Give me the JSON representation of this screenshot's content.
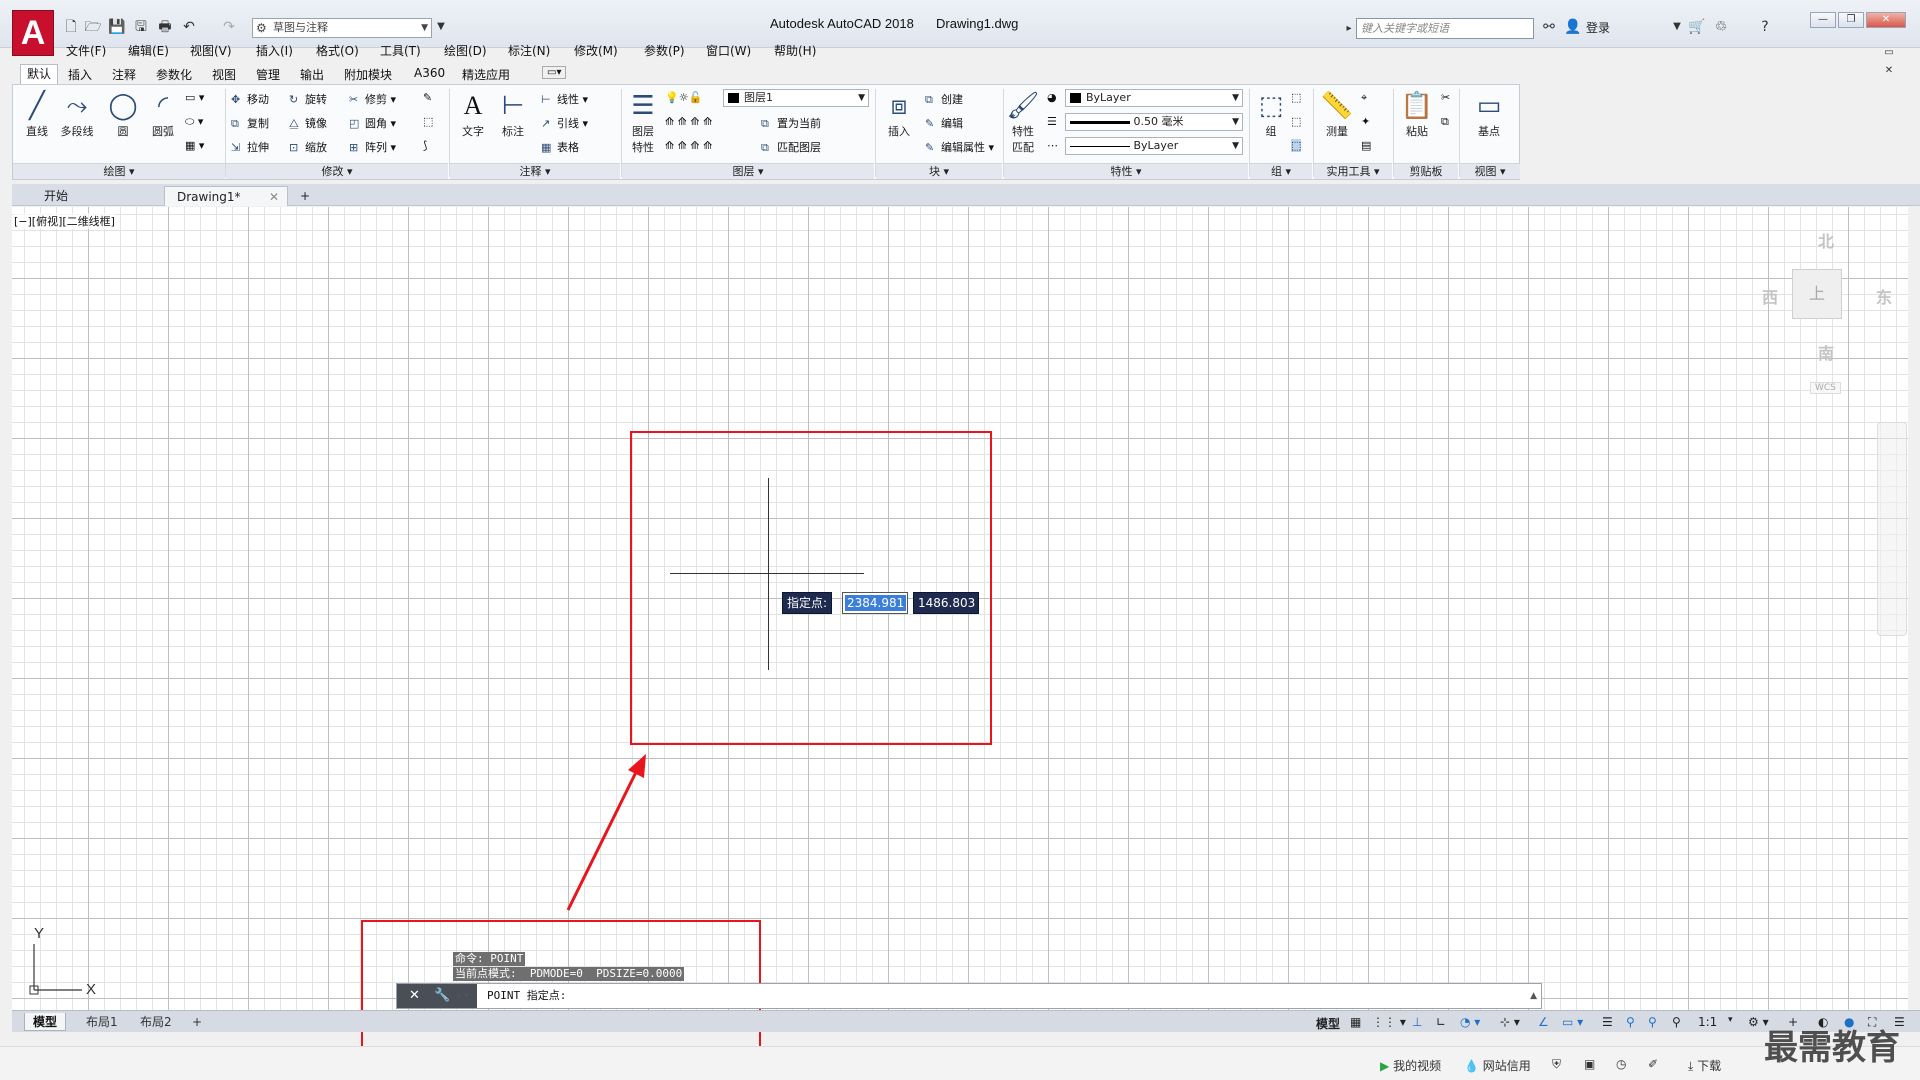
{
  "window": {
    "app_title": "Autodesk AutoCAD 2018",
    "doc_title": "Drawing1.dwg",
    "workspace": "草图与注释",
    "search_placeholder": "键入关键字或短语",
    "login": "登录",
    "logo_letter": "A"
  },
  "menu": [
    "文件(F)",
    "编辑(E)",
    "视图(V)",
    "插入(I)",
    "格式(O)",
    "工具(T)",
    "绘图(D)",
    "标注(N)",
    "修改(M)",
    "参数(P)",
    "窗口(W)",
    "帮助(H)"
  ],
  "ribbon_tabs": [
    "默认",
    "插入",
    "注释",
    "参数化",
    "视图",
    "管理",
    "输出",
    "附加模块",
    "A360",
    "精选应用"
  ],
  "ribbon": {
    "draw": {
      "title": "绘图",
      "tools": [
        "直线",
        "多段线",
        "圆",
        "圆弧"
      ]
    },
    "modify": {
      "title": "修改",
      "tools": [
        "移动",
        "旋转",
        "修剪",
        "复制",
        "镜像",
        "圆角",
        "拉伸",
        "缩放",
        "阵列"
      ]
    },
    "annotation": {
      "title": "注释",
      "tools": [
        "文字",
        "标注",
        "线性",
        "引线",
        "表格"
      ]
    },
    "layers": {
      "title": "图层",
      "layer_props": "图层\n特性",
      "current_layer": "图层1",
      "set_current": "置为当前",
      "match_layer": "匹配图层",
      "props_label1": "图层",
      "props_label2": "特性"
    },
    "block": {
      "title": "块",
      "insert": "插入",
      "create": "创建",
      "edit": "编辑",
      "edit_attr": "编辑属性"
    },
    "properties": {
      "title": "特性",
      "match1": "特性",
      "match2": "匹配",
      "color": "ByLayer",
      "lineweight": "0.50 毫米",
      "linetype": "ByLayer"
    },
    "groups": {
      "title": "组",
      "tool": "组"
    },
    "utilities": {
      "title": "实用工具",
      "tool": "测量"
    },
    "clipboard": {
      "title": "剪贴板",
      "tool": "粘贴"
    },
    "view": {
      "title": "视图",
      "tool": "基点"
    }
  },
  "file_tabs": {
    "start": "开始",
    "drawing": "Drawing1*"
  },
  "viewport_label": "[−][俯视][二维线框]",
  "viewcube": {
    "north": "北",
    "south": "南",
    "east": "东",
    "west": "西",
    "face": "上",
    "wcs": "WCS"
  },
  "dynamic_input": {
    "prompt": "指定点:",
    "x": "2384.981",
    "y": "1486.803"
  },
  "ucs": {
    "x": "X",
    "y": "Y"
  },
  "command_history": [
    "命令: POINT",
    "当前点模式:  PDMODE=0  PDSIZE=0.0000"
  ],
  "command_line": "POINT 指定点:",
  "layout_tabs": [
    "模型",
    "布局1",
    "布局2"
  ],
  "status": {
    "model": "模型",
    "scale": "1:1"
  },
  "bottom_strip": {
    "my_video": "我的视频",
    "credit": "网站信用",
    "download": "下载"
  },
  "watermark": "最需教育",
  "colors": {
    "annotation_red": "#e8151c",
    "dyn_input_bg": "#1e2a4e",
    "logo_red": "#c8102e"
  }
}
